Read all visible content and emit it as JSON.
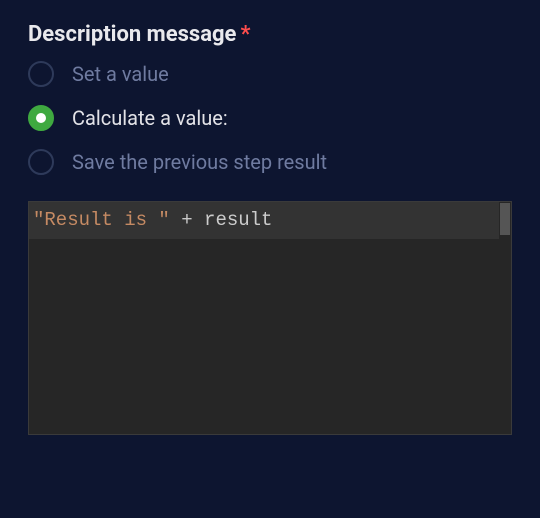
{
  "field": {
    "label": "Description message",
    "required_mark": "*"
  },
  "options": {
    "set": {
      "label": "Set a value",
      "selected": false
    },
    "calc": {
      "label": "Calculate a value:",
      "selected": true
    },
    "save": {
      "label": "Save the previous step result",
      "selected": false
    }
  },
  "code": {
    "tokens": {
      "string": "\"Result is \"",
      "op": " + ",
      "id": "result"
    }
  }
}
